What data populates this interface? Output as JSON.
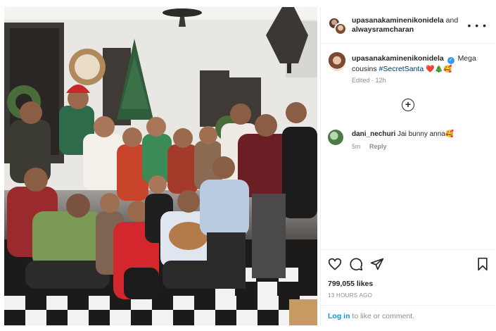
{
  "post": {
    "author": "upasanakaminenikonidela",
    "connector": "and",
    "collaborator": "alwaysramcharan",
    "more_label": "• • •",
    "photo_alt": "Group photo"
  },
  "caption": {
    "username": "upasanakaminenikonidela",
    "verified_mark": "✓",
    "text": "Mega cousins",
    "hashtag": "#SecretSanta",
    "emojis": "❤️🎄🥰",
    "edited": "Edited · 12h"
  },
  "load_more_label": "+",
  "comment": {
    "username": "dani_nechuri",
    "text": "Jai bunny anna🥰",
    "age": "5m",
    "reply": "Reply"
  },
  "stats": {
    "likes": "799,055 likes",
    "posted": "13 HOURS AGO"
  },
  "login": {
    "link": "Log in",
    "rest": " to like or comment."
  },
  "icons": [
    "heart-icon",
    "comment-icon",
    "share-icon",
    "bookmark-icon",
    "more-options-icon",
    "add-comment-icon"
  ]
}
